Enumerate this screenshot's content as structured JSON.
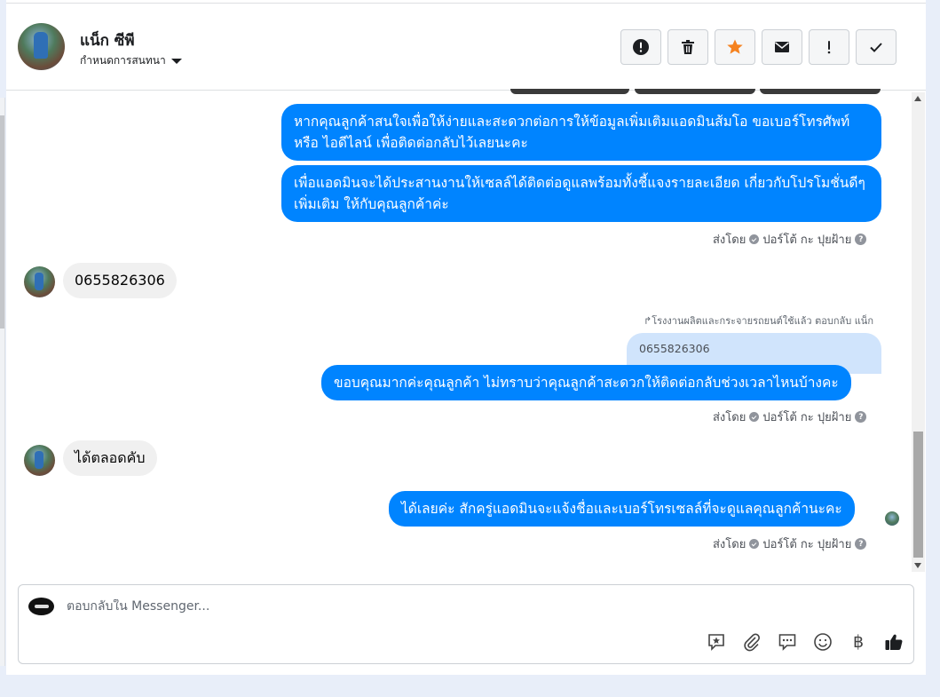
{
  "header": {
    "contact_name": "แน็ก ซีพี",
    "subtitle": "กำหนดการสนทนา"
  },
  "toolbar": {
    "buttons": [
      {
        "name": "report",
        "icon": "exclamation-circle-icon"
      },
      {
        "name": "delete",
        "icon": "trash-icon"
      },
      {
        "name": "star",
        "icon": "star-icon",
        "color": "#f5821f"
      },
      {
        "name": "mark-unread",
        "icon": "envelope-icon"
      },
      {
        "name": "important",
        "icon": "exclamation-icon"
      },
      {
        "name": "done",
        "icon": "checkmark-icon"
      }
    ]
  },
  "messages": {
    "m1": "หากคุณลูกค้าสนใจเพื่อให้ง่ายและสะดวกต่อการให้ข้อมูลเพิ่มเติมแอดมินส้มโอ ขอเบอร์โทรศัพท์ หรือ ไอดีไลน์ เพื่อติดต่อกลับไว้เลยนะคะ",
    "m2": "เพื่อแอดมินจะได้ประสานงานให้เซลล์ได้ติดต่อดูแลพร้อมทั้งชี้แจงรายละเอียด เกี่ยวกับโปรโมชั่นดีๆเพิ่มเติม ให้กับคุณลูกค้าค่ะ",
    "sent_by_1": "ส่งโดย",
    "sender_1": "ปอร์โต้ กะ ปุยฝ้าย",
    "in1": "0655826306",
    "reply_note": "โรงงานผลิตและกระจายรถยนต์ใช้แล้ว ตอบกลับ แน็ก",
    "quoted": "0655826306",
    "m3": "ขอบคุณมากค่ะคุณลูกค้า ไม่ทราบว่าคุณลูกค้าสะดวกให้ติดต่อกลับช่วงเวลาไหนบ้างคะ",
    "sent_by_2": "ส่งโดย",
    "sender_2": "ปอร์โต้ กะ ปุยฝ้าย",
    "in2": "ได้ตลอดคับ",
    "m4": "ได้เลยค่ะ สักครู่แอดมินจะแจ้งชื่อและเบอร์โทรเซลล์ที่จะดูแลคุณลูกค้านะคะ",
    "sent_by_3": "ส่งโดย",
    "sender_3": "ปอร์โต้ กะ ปุยฝ้าย"
  },
  "composer": {
    "placeholder": "ตอบกลับใน Messenger...",
    "icons": [
      "saved-reply-icon",
      "attachment-icon",
      "chat-bubble-icon",
      "emoji-icon",
      "baht-icon",
      "thumbs-up-icon"
    ],
    "currency_symbol": "฿"
  },
  "colors": {
    "outgoing_bubble": "#0084ff",
    "incoming_bubble": "#f0f0f0",
    "quoted_bubble": "#d0e4fc"
  }
}
